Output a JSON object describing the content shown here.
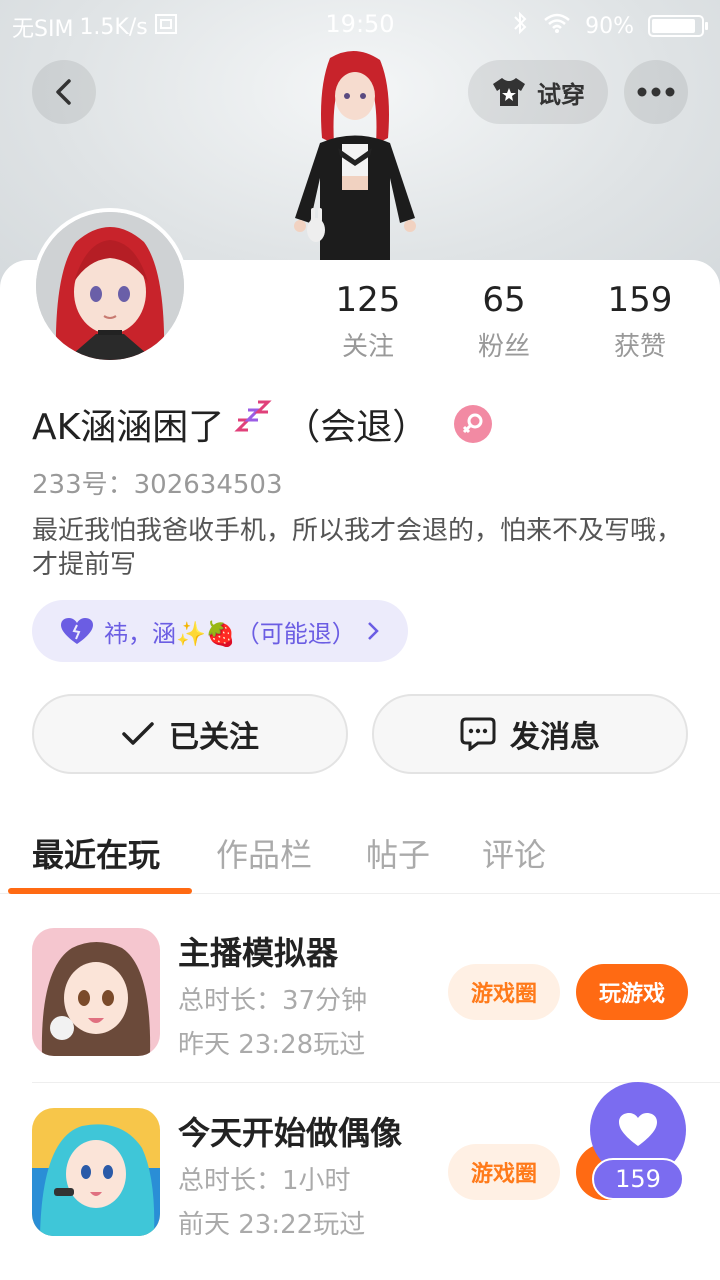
{
  "status_bar": {
    "carrier": "无SIM",
    "speed": "1.5K/s",
    "time": "19:50",
    "battery": "90%",
    "battery_level": 0.9
  },
  "header": {
    "tryon_label": "试穿"
  },
  "profile": {
    "username": "AK涵涵困了",
    "username_suffix": "（会退）",
    "uid": "233号：302634503",
    "bio": "最近我怕我爸收手机，所以我才会退的，怕来不及写哦，才提前写",
    "tag": "祎，涵✨🍓（可能退）"
  },
  "stats": [
    {
      "value": "125",
      "label": "关注"
    },
    {
      "value": "65",
      "label": "粉丝"
    },
    {
      "value": "159",
      "label": "获赞"
    }
  ],
  "actions": {
    "follow_label": "已关注",
    "message_label": "发消息"
  },
  "tabs": [
    {
      "label": "最近在玩"
    },
    {
      "label": "作品栏"
    },
    {
      "label": "帖子"
    },
    {
      "label": "评论"
    }
  ],
  "games": [
    {
      "name": "主播模拟器",
      "duration": "总时长：37分钟",
      "last_played": "昨天 23:28玩过",
      "circle_label": "游戏圈",
      "play_label": "玩游戏"
    },
    {
      "name": "今天开始做偶像",
      "duration": "总时长：1小时",
      "last_played": "前天 23:22玩过",
      "circle_label": "游戏圈"
    }
  ],
  "like_fab": {
    "count": "159"
  },
  "colors": {
    "accent": "#ff6a13",
    "purple": "#7b6cf0",
    "pink": "#f28aa3"
  }
}
